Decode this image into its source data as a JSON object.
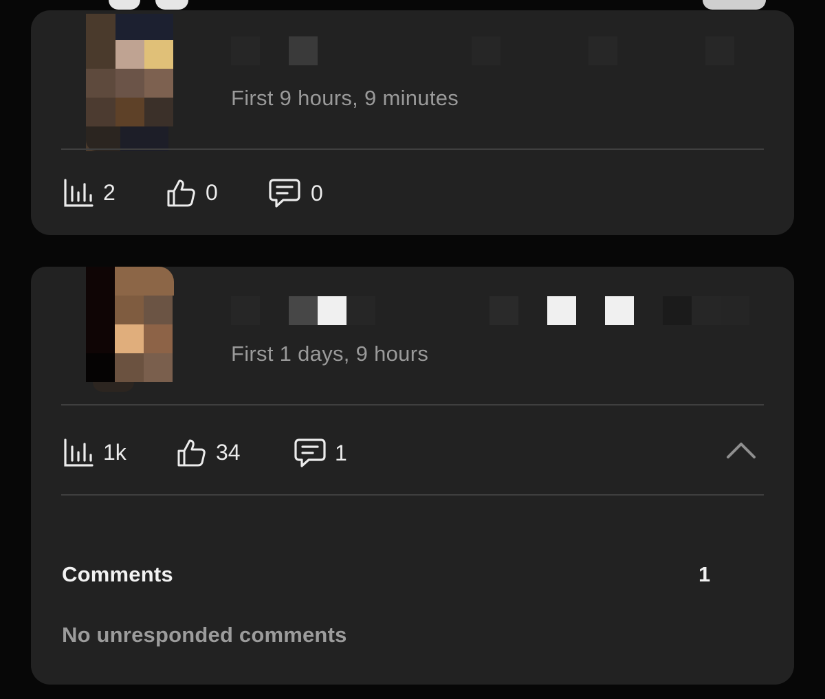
{
  "colors": {
    "background": "#070707",
    "card": "#222222",
    "divider": "#3f3f3f",
    "text_primary": "#ececec",
    "text_secondary": "#9a9a9a"
  },
  "posts": [
    {
      "subtitle": "First 9 hours, 9 minutes",
      "stats": {
        "views": "2",
        "likes": "0",
        "comments": "0"
      }
    },
    {
      "subtitle": "First 1 days, 9 hours",
      "stats": {
        "views": "1k",
        "likes": "34",
        "comments": "1"
      },
      "expanded": true,
      "comments_section": {
        "label": "Comments",
        "count": "1",
        "empty_message": "No unresponded comments"
      }
    }
  ],
  "icons": {
    "views": "bar-chart-icon",
    "likes": "thumbs-up-icon",
    "comments": "message-icon",
    "collapse": "chevron-up-icon"
  }
}
